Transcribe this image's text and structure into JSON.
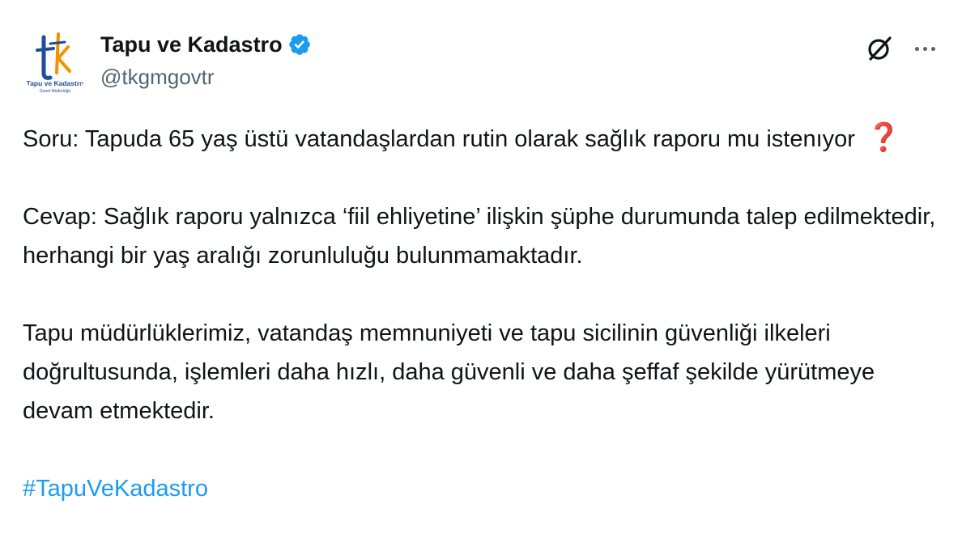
{
  "author": {
    "display_name": "Tapu ve Kadastro",
    "handle": "@tkgmgovtr",
    "avatar_text": "Tapu ve Kadastro",
    "avatar_subtext": "Genel Müdürlüğü"
  },
  "tweet": {
    "question_line": "Soru: Tapuda 65 yaş üstü vatandaşlardan rutin olarak sağlık raporu mu istenıyor",
    "question_emoji": "❓",
    "answer": "Cevap: Sağlık raporu yalnızca ‘fiil ehliyetine’ ilişkin şüphe durumunda talep edilmektedir, herhangi bir yaş aralığı zorunluluğu bulunmamaktadır.",
    "statement": "Tapu müdürlüklerimiz, vatandaş memnuniyeti ve tapu sicilinin güvenliği ilkeleri doğrultusunda, işlemleri daha hızlı, daha güvenli ve daha şeffaf şekilde yürütmeye devam etmektedir.",
    "hashtag": "#TapuVeKadastro"
  },
  "colors": {
    "text": "#0f1419",
    "secondary": "#536471",
    "link": "#1d9bf0",
    "verified": "#1d9bf0",
    "emoji_red": "#be1931"
  },
  "icons": {
    "verified": "verified-badge-icon",
    "grok": "grok-icon",
    "more": "more-options-icon"
  }
}
